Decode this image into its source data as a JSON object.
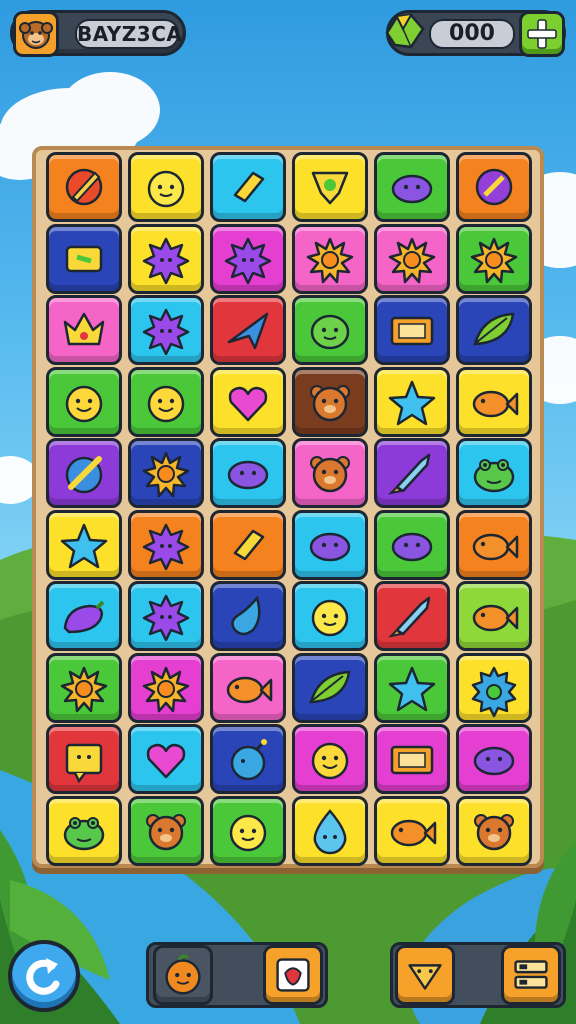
{
  "header": {
    "profile_name": "BAYZ3CA",
    "currency_value": "000"
  },
  "colors": {
    "orange": "#f4821e",
    "yellow": "#fde02a",
    "cyan": "#2cc5ee",
    "green": "#4ac83a",
    "blue": "#2a45b8",
    "pink": "#f565c8",
    "magenta": "#e43fd0",
    "red": "#e2363d",
    "lime": "#8fd83a",
    "brown": "#7a3c1e",
    "purple": "#8c3ad8"
  },
  "board": {
    "rows": [
      [
        {
          "color": "orange",
          "icon": "pencil-icon"
        },
        {
          "color": "yellow",
          "icon": "lemon-face-icon"
        },
        {
          "color": "cyan",
          "icon": "crystal-icon"
        },
        {
          "color": "yellow",
          "icon": "shield-icon"
        },
        {
          "color": "green",
          "icon": "blob-icon"
        },
        {
          "color": "orange",
          "icon": "compass-icon"
        }
      ],
      [
        {
          "color": "blue",
          "icon": "scroll-icon"
        },
        {
          "color": "yellow",
          "icon": "spiky-ball-icon"
        },
        {
          "color": "magenta",
          "icon": "spiky-ball-icon"
        },
        {
          "color": "pink",
          "icon": "sun-icon"
        },
        {
          "color": "pink",
          "icon": "sun-icon"
        },
        {
          "color": "green",
          "icon": "sun-icon"
        }
      ],
      [
        {
          "color": "pink",
          "icon": "crown-icon"
        },
        {
          "color": "cyan",
          "icon": "spiky-ball-icon"
        },
        {
          "color": "red",
          "icon": "arrow-icon"
        },
        {
          "color": "green",
          "icon": "slime-face-icon"
        },
        {
          "color": "blue",
          "icon": "sign-icon"
        },
        {
          "color": "blue",
          "icon": "leaf-icon"
        }
      ],
      [
        {
          "color": "green",
          "icon": "smiley-icon"
        },
        {
          "color": "green",
          "icon": "smiley-icon"
        },
        {
          "color": "yellow",
          "icon": "heart-icon"
        },
        {
          "color": "brown",
          "icon": "bear-icon"
        },
        {
          "color": "yellow",
          "icon": "star-icon"
        },
        {
          "color": "yellow",
          "icon": "fish-icon"
        }
      ],
      [
        {
          "color": "purple",
          "icon": "sword-icon"
        },
        {
          "color": "blue",
          "icon": "sun-icon"
        },
        {
          "color": "cyan",
          "icon": "blob-icon"
        },
        {
          "color": "pink",
          "icon": "bear-icon"
        },
        {
          "color": "purple",
          "icon": "rocket-icon"
        },
        {
          "color": "cyan",
          "icon": "frog-icon"
        }
      ],
      [
        {
          "color": "yellow",
          "icon": "star-icon"
        },
        {
          "color": "orange",
          "icon": "spiky-ball-icon"
        },
        {
          "color": "orange",
          "icon": "crystal-icon"
        },
        {
          "color": "cyan",
          "icon": "blob-icon"
        },
        {
          "color": "green",
          "icon": "blob-icon"
        },
        {
          "color": "orange",
          "icon": "fish-icon"
        }
      ],
      [
        {
          "color": "cyan",
          "icon": "eggplant-icon"
        },
        {
          "color": "cyan",
          "icon": "spiky-ball-icon"
        },
        {
          "color": "blue",
          "icon": "drop-icon"
        },
        {
          "color": "cyan",
          "icon": "lemon-face-icon"
        },
        {
          "color": "red",
          "icon": "rocket-icon"
        },
        {
          "color": "lime",
          "icon": "fish-icon"
        }
      ],
      [
        {
          "color": "green",
          "icon": "sun-icon"
        },
        {
          "color": "magenta",
          "icon": "sun-icon"
        },
        {
          "color": "pink",
          "icon": "fish-icon"
        },
        {
          "color": "blue",
          "icon": "leaf-icon"
        },
        {
          "color": "green",
          "icon": "star-icon"
        },
        {
          "color": "yellow",
          "icon": "gear-icon"
        }
      ],
      [
        {
          "color": "red",
          "icon": "note-icon"
        },
        {
          "color": "cyan",
          "icon": "heart-icon"
        },
        {
          "color": "blue",
          "icon": "bomb-icon"
        },
        {
          "color": "magenta",
          "icon": "smiley-icon"
        },
        {
          "color": "magenta",
          "icon": "sign-icon"
        },
        {
          "color": "magenta",
          "icon": "blob-icon"
        }
      ],
      [
        {
          "color": "yellow",
          "icon": "frog-icon"
        },
        {
          "color": "green",
          "icon": "bear-icon"
        },
        {
          "color": "green",
          "icon": "lemon-face-icon"
        },
        {
          "color": "yellow",
          "icon": "drop-face-icon"
        },
        {
          "color": "yellow",
          "icon": "fish-icon"
        },
        {
          "color": "yellow",
          "icon": "bear-icon"
        }
      ]
    ]
  },
  "bottom_bar": {
    "undo": {
      "icon": "undo-icon"
    },
    "boosters": [
      {
        "icon": "orange-face-icon",
        "color": "#4a5563"
      },
      {
        "icon": "card-icon",
        "color": "#f6a22a"
      }
    ],
    "right_buttons": [
      {
        "icon": "shield-icon",
        "color": "#f6a22a"
      },
      {
        "icon": "menu-icon",
        "color": "#f6a22a"
      }
    ]
  }
}
